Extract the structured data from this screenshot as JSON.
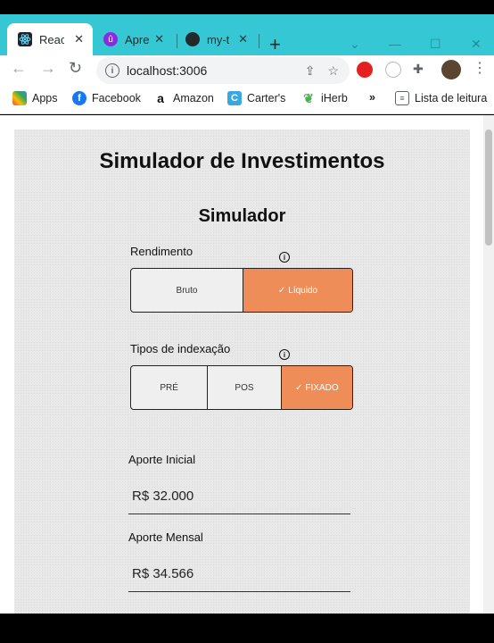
{
  "browser": {
    "tabs": [
      {
        "title": "React",
        "active": true,
        "favicon_color": "#20232a"
      },
      {
        "title": "Apre",
        "active": false,
        "favicon_color": "#8a2be2"
      },
      {
        "title": "my-t",
        "active": false,
        "favicon_color": "#24292e"
      }
    ],
    "new_tab": "+",
    "address": "localhost:3006",
    "bookmarks": [
      {
        "label": "Apps",
        "icon": "apps-grid-icon"
      },
      {
        "label": "Facebook",
        "icon": "facebook-icon"
      },
      {
        "label": "Amazon",
        "icon": "amazon-icon"
      },
      {
        "label": "Carter's",
        "icon": "carters-icon"
      },
      {
        "label": "iHerb",
        "icon": "iherb-leaf-icon"
      }
    ],
    "more": "»",
    "reading_list": "Lista de leitura"
  },
  "page": {
    "title": "Simulador de Investimentos",
    "subtitle": "Simulador",
    "rendimento": {
      "label": "Rendimento",
      "options": [
        "Bruto",
        "Líquido"
      ],
      "selected": "Líquido"
    },
    "indexacao": {
      "label": "Tipos de indexação",
      "options": [
        "PRÉ",
        "POS",
        "FIXADO"
      ],
      "selected": "FIXADO"
    },
    "aporte_inicial": {
      "label": "Aporte Inicial",
      "value": "R$ 32.000"
    },
    "aporte_mensal": {
      "label": "Aporte Mensal",
      "value": "R$ 34.566"
    }
  },
  "colors": {
    "accent": "#ee8d58",
    "tabstrip": "#35c7d3"
  }
}
